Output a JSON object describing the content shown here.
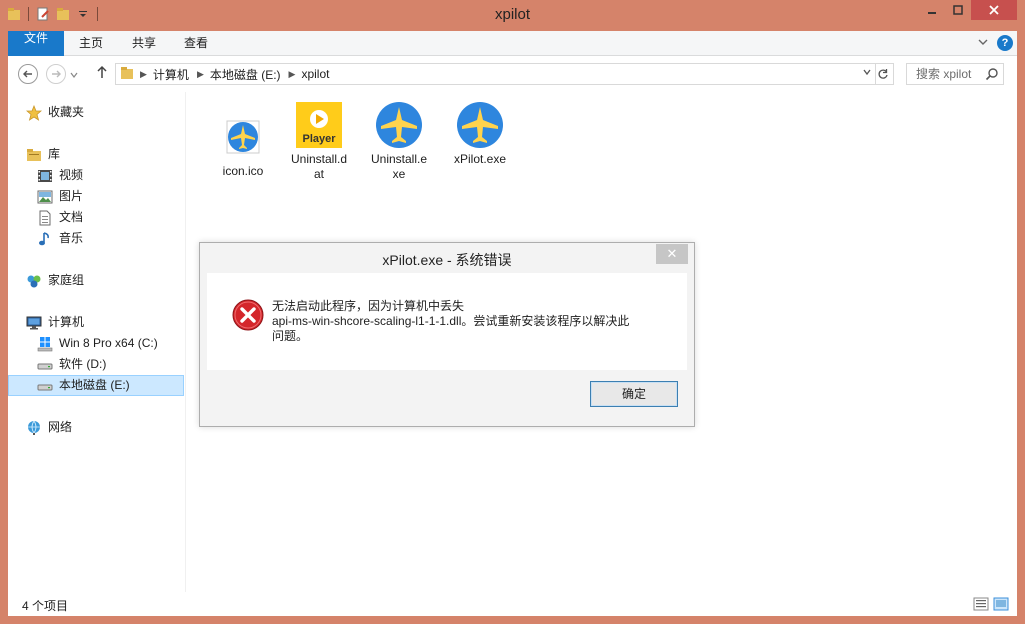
{
  "window": {
    "title": "xpilot"
  },
  "ribbon": {
    "tabs": [
      {
        "label": "文件"
      },
      {
        "label": "主页"
      },
      {
        "label": "共享"
      },
      {
        "label": "查看"
      }
    ],
    "help_label": "?"
  },
  "address": {
    "crumbs": [
      "计算机",
      "本地磁盘 (E:)",
      "xpilot"
    ],
    "search_placeholder": "搜索 xpilot"
  },
  "nav": {
    "favorites": "收藏夹",
    "library": "库",
    "videos": "视频",
    "pictures": "图片",
    "documents": "文档",
    "music": "音乐",
    "homegroup": "家庭组",
    "computer": "计算机",
    "drive_c": "Win 8 Pro x64 (C:)",
    "drive_d": "软件 (D:)",
    "drive_e": "本地磁盘 (E:)",
    "network": "网络"
  },
  "files": [
    {
      "name": "icon.ico",
      "icon": "airplane-ico-icon"
    },
    {
      "name": "Uninstall.dat",
      "icon": "player-icon",
      "badge": "Player"
    },
    {
      "name": "Uninstall.exe",
      "icon": "airplane-icon"
    },
    {
      "name": "xPilot.exe",
      "icon": "airplane-icon"
    }
  ],
  "status": {
    "count": "4 个项目"
  },
  "dialog": {
    "title": "xPilot.exe - 系统错误",
    "close": "✕",
    "message_line1": "无法启动此程序，因为计算机中丢失",
    "message_line2": "api-ms-win-shcore-scaling-l1-1-1.dll。尝试重新安装该程序以解决此",
    "message_line3": "问题。",
    "ok_label": "确定"
  },
  "colors": {
    "frame": "#d5836a",
    "file_tab": "#1979ca",
    "close_button": "#c7504e",
    "selection": "#cce8ff",
    "error_red": "#d4262b"
  }
}
